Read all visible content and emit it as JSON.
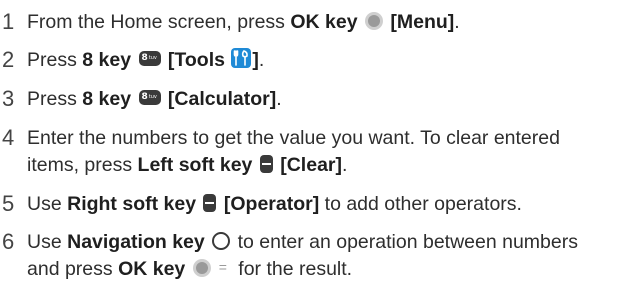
{
  "steps": [
    {
      "num": "1",
      "lead": "From the Home screen, press ",
      "key": "OK key",
      "label": "[Menu]",
      "tail": "."
    },
    {
      "num": "2",
      "lead": "Press ",
      "key": "8 key",
      "label_a": "[Tools",
      "label_b": "]",
      "tail": "."
    },
    {
      "num": "3",
      "lead": "Press ",
      "key": "8 key",
      "label": "[Calculator]",
      "tail": "."
    },
    {
      "num": "4",
      "line1": "Enter the numbers to get the value you want. To clear entered",
      "lead2": "items, press ",
      "key": "Left soft key",
      "label": "[Clear]",
      "tail": "."
    },
    {
      "num": "5",
      "lead": "Use ",
      "key": "Right soft key",
      "label": "[Operator]",
      "tail": " to add other operators."
    },
    {
      "num": "6",
      "lead": "Use ",
      "key": "Navigation key",
      "mid": " to enter an operation between numbers",
      "lead2": "and press ",
      "key2": "OK key",
      "eq": "=",
      "tail": " for the result."
    }
  ],
  "icons": {
    "ok": "ok-key-icon",
    "eight": "8-key-icon",
    "eight_text": "8",
    "eight_sub": "tuv",
    "tools": "tools-icon",
    "soft": "soft-key-icon",
    "nav": "navigation-key-icon"
  },
  "colors": {
    "tools_bg": "#1f8ad6",
    "key_bg": "#3a3a3a",
    "ok_ring": "#cfcfcf"
  }
}
